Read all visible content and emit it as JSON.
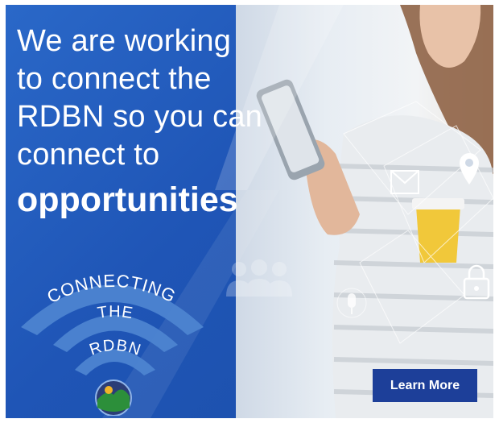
{
  "headline": {
    "line1": "We are working",
    "line2": "to connect the",
    "line3": "RDBN so you can",
    "line4": "connect to",
    "emphasis": "opportunities"
  },
  "logo": {
    "line1": "CONNECTING",
    "line2": "THE",
    "line3": "RDBN"
  },
  "cta": {
    "label": "Learn More"
  },
  "colors": {
    "primary_blue": "#1f55b6",
    "button_blue": "#1d3f99",
    "text_white": "#ffffff"
  },
  "icons": [
    "email-icon",
    "location-pin-icon",
    "lock-icon",
    "microphone-icon",
    "people-icon",
    "phone-icon",
    "coffee-cup-icon"
  ]
}
